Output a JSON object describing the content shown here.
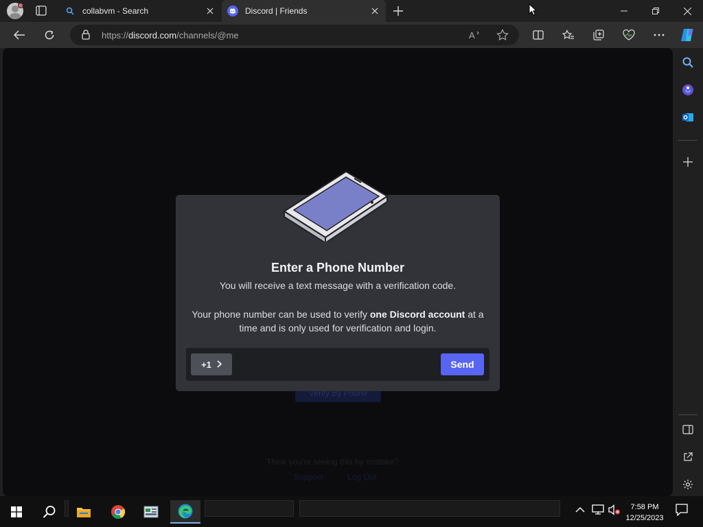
{
  "browser": {
    "tabs": [
      {
        "title": "collabvm - Search",
        "icon": "search-icon"
      },
      {
        "title": "Discord | Friends",
        "icon": "discord-icon",
        "active": true
      }
    ],
    "url_prefix": "https://",
    "url_domain": "discord.com",
    "url_path": "/channels/@me"
  },
  "modal": {
    "title": "Enter a Phone Number",
    "subtitle": "You will receive a text message with a verification code.",
    "note_before": "Your phone number can be used to verify ",
    "note_bold": "one Discord account",
    "note_after": " at a time and is only used for verification and login.",
    "country_code": "+1",
    "phone_value": "",
    "send_label": "Send"
  },
  "background": {
    "button_label": "Verify By Phone",
    "mistake_text": "Think you're seeing this by mistake?",
    "link_support": "Support",
    "link_log_out": "Log Out"
  },
  "taskbar": {
    "time": "7:58 PM",
    "date": "12/25/2023"
  },
  "colors": {
    "accent": "#5865f2",
    "modal_bg": "#313338",
    "input_bg": "#1e1f22",
    "country_bg": "#4e5058"
  }
}
